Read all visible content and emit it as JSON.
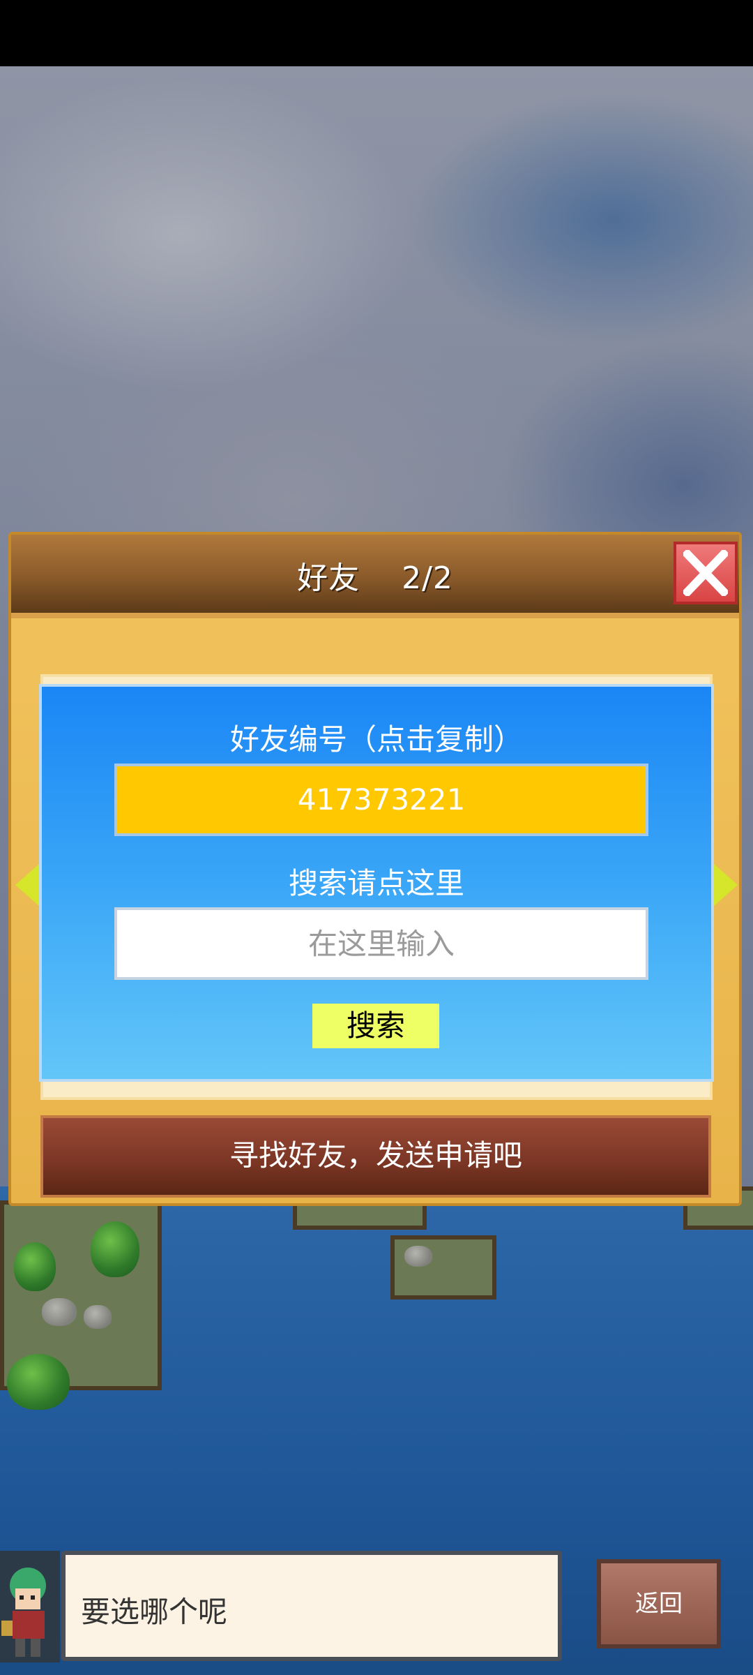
{
  "dialog": {
    "title": "好友　 2/2",
    "close_icon": "close-x-icon",
    "friend_id_label": "好友编号（点击复制）",
    "friend_id": "417373221",
    "search_label": "搜索请点这里",
    "search_placeholder": "在这里输入",
    "search_button": "搜索",
    "find_friends_button": "寻找好友，发送申请吧"
  },
  "bottom": {
    "message": "要选哪个呢",
    "back_button": "返回"
  },
  "colors": {
    "popup_top": "#1a86f5",
    "id_box": "#ffc800",
    "search_button": "#eeff66",
    "close_button": "#d94444"
  }
}
